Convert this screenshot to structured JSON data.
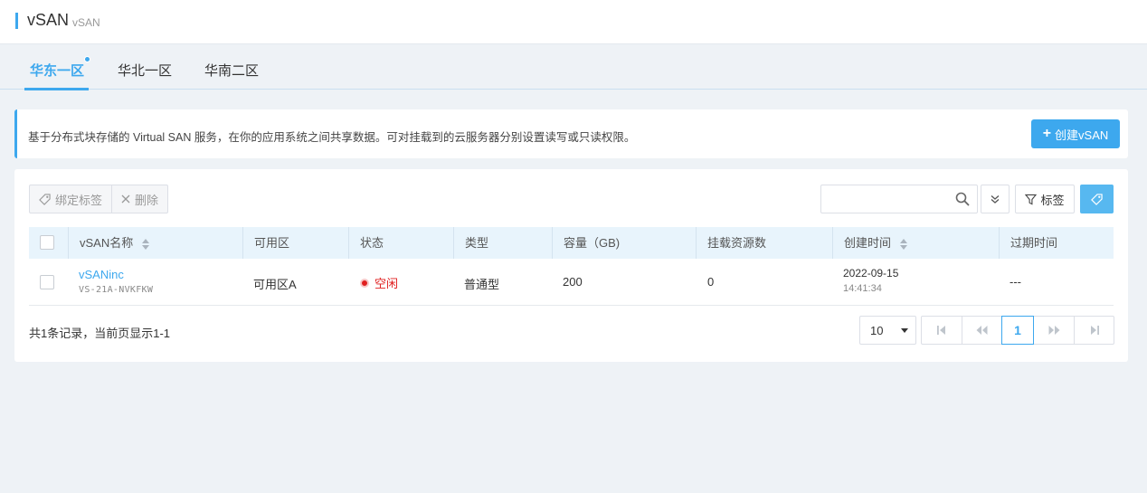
{
  "header": {
    "title": "vSAN",
    "subtitle": "vSAN"
  },
  "tabs": [
    {
      "label": "华东一区",
      "active": true
    },
    {
      "label": "华北一区",
      "active": false
    },
    {
      "label": "华南二区",
      "active": false
    }
  ],
  "banner": {
    "text": "基于分布式块存储的 Virtual SAN 服务，在你的应用系统之间共享数据。可对挂载到的云服务器分别设置读写或只读权限。",
    "create_button": "创建vSAN"
  },
  "toolbar": {
    "bind_tag": "绑定标签",
    "delete": "删除",
    "search_placeholder": "",
    "filter_tag": "标签"
  },
  "table": {
    "columns": [
      "vSAN名称",
      "可用区",
      "状态",
      "类型",
      "容量（GB)",
      "挂载资源数",
      "创建时间",
      "过期时间"
    ],
    "rows": [
      {
        "name": "vSANinc",
        "id": "VS-21A-NVKFKW",
        "zone": "可用区A",
        "status": "空闲",
        "type": "普通型",
        "capacity": "200",
        "mounts": "0",
        "created_date": "2022-09-15",
        "created_time": "14:41:34",
        "expire": "---"
      }
    ]
  },
  "footer": {
    "summary": "共1条记录，当前页显示1-1",
    "page_size": "10",
    "current_page": "1"
  },
  "colors": {
    "accent": "#3da8ee",
    "status_idle": "#e02020"
  }
}
